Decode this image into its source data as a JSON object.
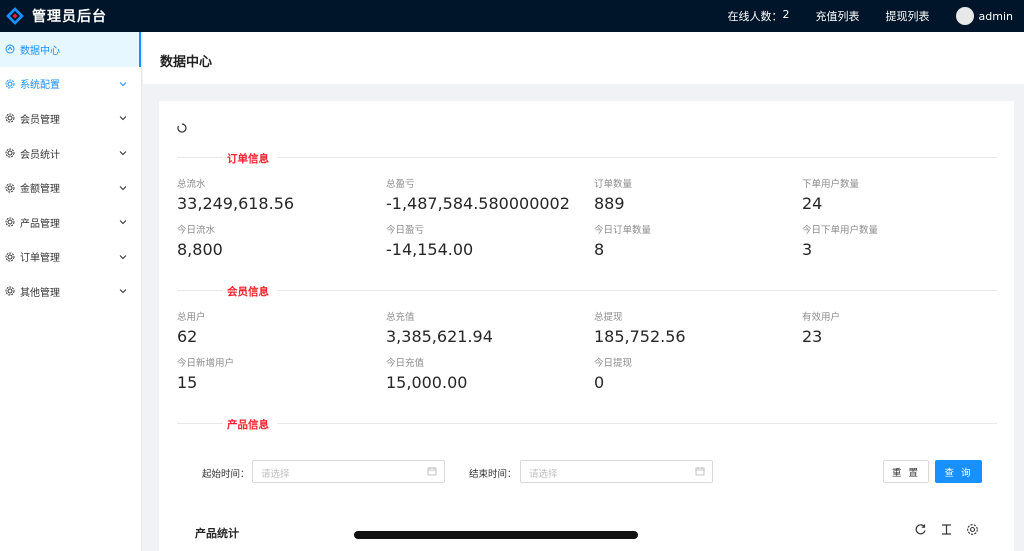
{
  "app": {
    "title": "管理员后台"
  },
  "topbar": {
    "online_label": "在线人数：",
    "online_count": "2",
    "recharge_list": "充值列表",
    "withdraw_list": "提现列表",
    "username": "admin"
  },
  "sidebar": {
    "items": [
      {
        "label": "数据中心",
        "icon": "dashboard-icon"
      },
      {
        "label": "系统配置",
        "icon": "settings-icon"
      },
      {
        "label": "会员管理",
        "icon": "settings-icon"
      },
      {
        "label": "会员统计",
        "icon": "settings-icon"
      },
      {
        "label": "金额管理",
        "icon": "settings-icon"
      },
      {
        "label": "产品管理",
        "icon": "settings-icon"
      },
      {
        "label": "订单管理",
        "icon": "settings-icon"
      },
      {
        "label": "其他管理",
        "icon": "settings-icon"
      }
    ]
  },
  "page": {
    "title": "数据中心"
  },
  "order_section": {
    "title": "订单信息",
    "stats": [
      {
        "label": "总流水",
        "value": "33,249,618.56"
      },
      {
        "label": "总盈亏",
        "value": "-1,487,584.580000002"
      },
      {
        "label": "订单数量",
        "value": "889"
      },
      {
        "label": "下单用户数量",
        "value": "24"
      },
      {
        "label": "今日流水",
        "value": "8,800"
      },
      {
        "label": "今日盈亏",
        "value": "-14,154.00"
      },
      {
        "label": "今日订单数量",
        "value": "8"
      },
      {
        "label": "今日下单用户数量",
        "value": "3"
      }
    ]
  },
  "member_section": {
    "title": "会员信息",
    "stats": [
      {
        "label": "总用户",
        "value": "62"
      },
      {
        "label": "总充值",
        "value": "3,385,621.94"
      },
      {
        "label": "总提现",
        "value": "185,752.56"
      },
      {
        "label": "有效用户",
        "value": "23"
      },
      {
        "label": "今日新增用户",
        "value": "15"
      },
      {
        "label": "今日充值",
        "value": "15,000.00"
      },
      {
        "label": "今日提现",
        "value": "0"
      }
    ]
  },
  "product_section": {
    "title": "产品信息",
    "start_label": "起始时间：",
    "start_placeholder": "请选择",
    "end_label": "结束时间：",
    "end_placeholder": "请选择",
    "reset": "重 置",
    "query": "查 询",
    "stats_title": "产品统计"
  },
  "colors": {
    "accent": "#1890ff",
    "section_title": "#f5222d",
    "topbar": "#001529"
  }
}
